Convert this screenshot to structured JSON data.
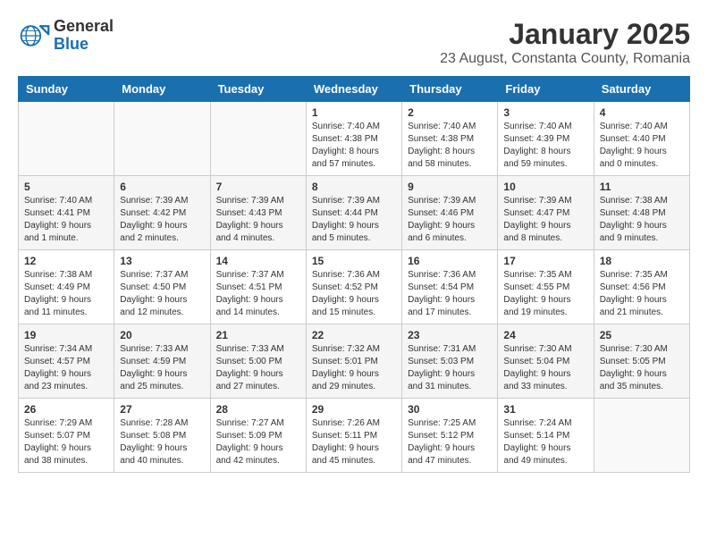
{
  "logo": {
    "general": "General",
    "blue": "Blue"
  },
  "header": {
    "title": "January 2025",
    "subtitle": "23 August, Constanta County, Romania"
  },
  "days_of_week": [
    "Sunday",
    "Monday",
    "Tuesday",
    "Wednesday",
    "Thursday",
    "Friday",
    "Saturday"
  ],
  "weeks": [
    [
      {
        "num": "",
        "details": ""
      },
      {
        "num": "",
        "details": ""
      },
      {
        "num": "",
        "details": ""
      },
      {
        "num": "1",
        "details": "Sunrise: 7:40 AM\nSunset: 4:38 PM\nDaylight: 8 hours and 57 minutes."
      },
      {
        "num": "2",
        "details": "Sunrise: 7:40 AM\nSunset: 4:38 PM\nDaylight: 8 hours and 58 minutes."
      },
      {
        "num": "3",
        "details": "Sunrise: 7:40 AM\nSunset: 4:39 PM\nDaylight: 8 hours and 59 minutes."
      },
      {
        "num": "4",
        "details": "Sunrise: 7:40 AM\nSunset: 4:40 PM\nDaylight: 9 hours and 0 minutes."
      }
    ],
    [
      {
        "num": "5",
        "details": "Sunrise: 7:40 AM\nSunset: 4:41 PM\nDaylight: 9 hours and 1 minute."
      },
      {
        "num": "6",
        "details": "Sunrise: 7:39 AM\nSunset: 4:42 PM\nDaylight: 9 hours and 2 minutes."
      },
      {
        "num": "7",
        "details": "Sunrise: 7:39 AM\nSunset: 4:43 PM\nDaylight: 9 hours and 4 minutes."
      },
      {
        "num": "8",
        "details": "Sunrise: 7:39 AM\nSunset: 4:44 PM\nDaylight: 9 hours and 5 minutes."
      },
      {
        "num": "9",
        "details": "Sunrise: 7:39 AM\nSunset: 4:46 PM\nDaylight: 9 hours and 6 minutes."
      },
      {
        "num": "10",
        "details": "Sunrise: 7:39 AM\nSunset: 4:47 PM\nDaylight: 9 hours and 8 minutes."
      },
      {
        "num": "11",
        "details": "Sunrise: 7:38 AM\nSunset: 4:48 PM\nDaylight: 9 hours and 9 minutes."
      }
    ],
    [
      {
        "num": "12",
        "details": "Sunrise: 7:38 AM\nSunset: 4:49 PM\nDaylight: 9 hours and 11 minutes."
      },
      {
        "num": "13",
        "details": "Sunrise: 7:37 AM\nSunset: 4:50 PM\nDaylight: 9 hours and 12 minutes."
      },
      {
        "num": "14",
        "details": "Sunrise: 7:37 AM\nSunset: 4:51 PM\nDaylight: 9 hours and 14 minutes."
      },
      {
        "num": "15",
        "details": "Sunrise: 7:36 AM\nSunset: 4:52 PM\nDaylight: 9 hours and 15 minutes."
      },
      {
        "num": "16",
        "details": "Sunrise: 7:36 AM\nSunset: 4:54 PM\nDaylight: 9 hours and 17 minutes."
      },
      {
        "num": "17",
        "details": "Sunrise: 7:35 AM\nSunset: 4:55 PM\nDaylight: 9 hours and 19 minutes."
      },
      {
        "num": "18",
        "details": "Sunrise: 7:35 AM\nSunset: 4:56 PM\nDaylight: 9 hours and 21 minutes."
      }
    ],
    [
      {
        "num": "19",
        "details": "Sunrise: 7:34 AM\nSunset: 4:57 PM\nDaylight: 9 hours and 23 minutes."
      },
      {
        "num": "20",
        "details": "Sunrise: 7:33 AM\nSunset: 4:59 PM\nDaylight: 9 hours and 25 minutes."
      },
      {
        "num": "21",
        "details": "Sunrise: 7:33 AM\nSunset: 5:00 PM\nDaylight: 9 hours and 27 minutes."
      },
      {
        "num": "22",
        "details": "Sunrise: 7:32 AM\nSunset: 5:01 PM\nDaylight: 9 hours and 29 minutes."
      },
      {
        "num": "23",
        "details": "Sunrise: 7:31 AM\nSunset: 5:03 PM\nDaylight: 9 hours and 31 minutes."
      },
      {
        "num": "24",
        "details": "Sunrise: 7:30 AM\nSunset: 5:04 PM\nDaylight: 9 hours and 33 minutes."
      },
      {
        "num": "25",
        "details": "Sunrise: 7:30 AM\nSunset: 5:05 PM\nDaylight: 9 hours and 35 minutes."
      }
    ],
    [
      {
        "num": "26",
        "details": "Sunrise: 7:29 AM\nSunset: 5:07 PM\nDaylight: 9 hours and 38 minutes."
      },
      {
        "num": "27",
        "details": "Sunrise: 7:28 AM\nSunset: 5:08 PM\nDaylight: 9 hours and 40 minutes."
      },
      {
        "num": "28",
        "details": "Sunrise: 7:27 AM\nSunset: 5:09 PM\nDaylight: 9 hours and 42 minutes."
      },
      {
        "num": "29",
        "details": "Sunrise: 7:26 AM\nSunset: 5:11 PM\nDaylight: 9 hours and 45 minutes."
      },
      {
        "num": "30",
        "details": "Sunrise: 7:25 AM\nSunset: 5:12 PM\nDaylight: 9 hours and 47 minutes."
      },
      {
        "num": "31",
        "details": "Sunrise: 7:24 AM\nSunset: 5:14 PM\nDaylight: 9 hours and 49 minutes."
      },
      {
        "num": "",
        "details": ""
      }
    ]
  ]
}
